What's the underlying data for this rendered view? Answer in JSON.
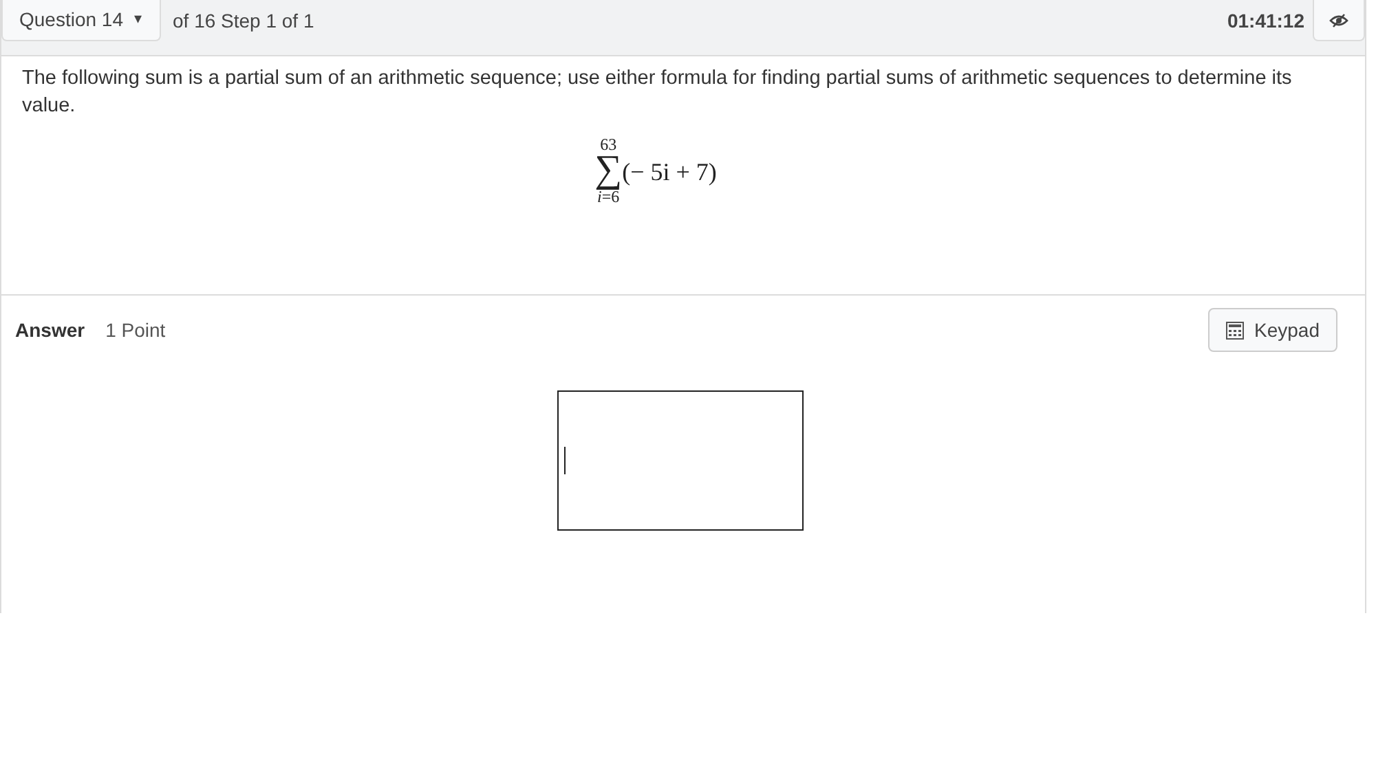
{
  "header": {
    "question_menu": {
      "label": "Question 14",
      "caret": "▾"
    },
    "progress": "of 16 Step 1 of 1",
    "timer": "01:41:12"
  },
  "question": {
    "text": "The following sum is a partial sum of an arithmetic sequence; use either formula for finding partial sums of arithmetic sequences to determine its value.",
    "formula": {
      "upper": "63",
      "symbol": "∑",
      "lower": "*i*=6",
      "expression": "(− 5i + 7)"
    }
  },
  "answer": {
    "label": "Answer",
    "points": "1 Point",
    "keypad_button": "Keypad",
    "field": {
      "focused": true
    }
  }
}
